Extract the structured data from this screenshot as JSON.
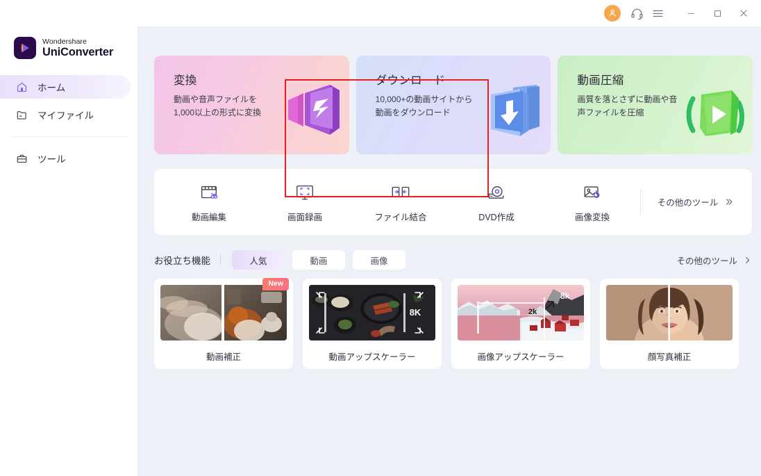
{
  "window": {
    "titlebar": {
      "avatar_icon": "user-avatar-icon",
      "support_icon": "headset-icon",
      "menu_icon": "hamburger-menu-icon",
      "minimize_icon": "minimize-icon",
      "maximize_icon": "maximize-icon",
      "close_icon": "close-icon"
    }
  },
  "sidebar": {
    "brand": {
      "top": "Wondershare",
      "bottom": "UniConverter",
      "icon": "uniconverter-logo-icon"
    },
    "items": [
      {
        "label": "ホーム",
        "icon": "home-icon",
        "active": true
      },
      {
        "label": "マイファイル",
        "icon": "folder-icon",
        "active": false
      },
      {
        "label": "ツール",
        "icon": "briefcase-icon",
        "active": false
      }
    ]
  },
  "main": {
    "hero_cards": [
      {
        "title": "変換",
        "desc": "動画や音声ファイルを1,000以上の形式に変換",
        "art": "convert-art-icon",
        "highlighted": true
      },
      {
        "title": "ダウンロード",
        "desc": "10,000+の動画サイトから動画をダウンロード",
        "art": "download-art-icon",
        "highlighted": false
      },
      {
        "title": "動画圧縮",
        "desc": "画質を落とさずに動画や音声ファイルを圧縮",
        "art": "compress-art-icon",
        "highlighted": false
      }
    ],
    "tools": [
      {
        "label": "動画編集",
        "icon": "video-edit-icon"
      },
      {
        "label": "画面録画",
        "icon": "screen-record-icon"
      },
      {
        "label": "ファイル結合",
        "icon": "merge-files-icon"
      },
      {
        "label": "DVD作成",
        "icon": "dvd-burn-icon"
      },
      {
        "label": "画像変換",
        "icon": "image-convert-icon"
      }
    ],
    "tools_more": {
      "label": "その他のツール",
      "icon": "double-chevron-right-icon"
    },
    "section": {
      "title": "お役立ち機能",
      "tabs": [
        {
          "label": "人気",
          "active": true
        },
        {
          "label": "動画",
          "active": false
        },
        {
          "label": "画像",
          "active": false
        }
      ],
      "more": {
        "label": "その他のツール",
        "icon": "chevron-right-icon"
      }
    },
    "features": [
      {
        "label": "動画補正",
        "badge": "New",
        "thumb": "dog-street-photo",
        "overlay": ""
      },
      {
        "label": "動画アップスケーラー",
        "badge": "",
        "thumb": "food-table-photo",
        "overlay": "8K"
      },
      {
        "label": "画像アップスケーラー",
        "badge": "",
        "thumb": "snow-village-photo",
        "overlay_from": "2k",
        "overlay_to": "8k"
      },
      {
        "label": "顔写真補正",
        "badge": "",
        "thumb": "portrait-photo",
        "overlay": ""
      }
    ]
  },
  "colors": {
    "accent_purple": "#7b5cf0",
    "highlight_red": "#e41f1f",
    "badge_orange": "#fc7a6d",
    "main_bg": "#eef0f8"
  }
}
